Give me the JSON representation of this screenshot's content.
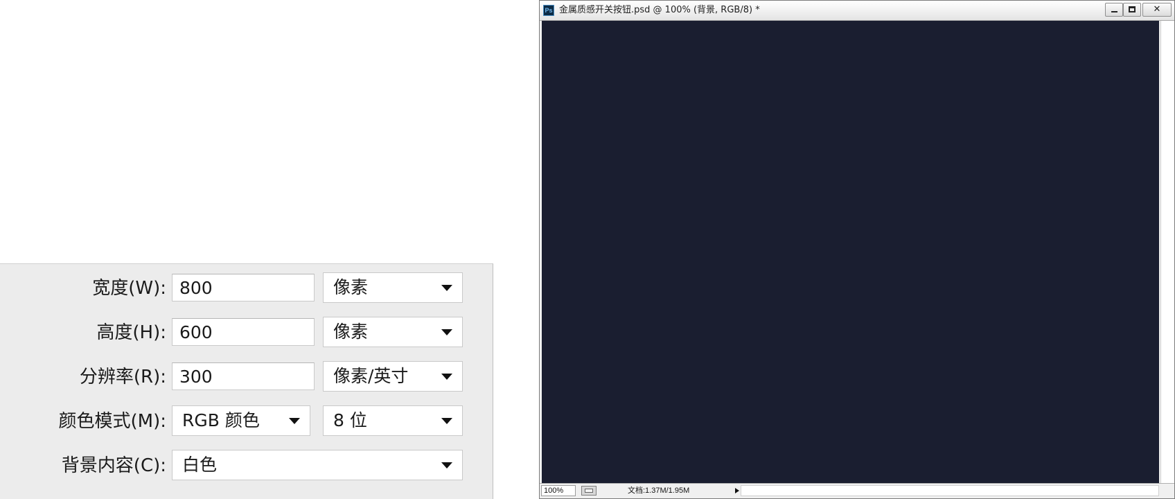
{
  "dialog": {
    "width": {
      "label": "宽度(W):",
      "value": "800",
      "unit": "像素"
    },
    "height": {
      "label": "高度(H):",
      "value": "600",
      "unit": "像素"
    },
    "resolution": {
      "label": "分辨率(R):",
      "value": "300",
      "unit": "像素/英寸"
    },
    "color_mode": {
      "label": "颜色模式(M):",
      "mode": "RGB 颜色",
      "bit_depth": "8 位"
    },
    "background": {
      "label": "背景内容(C):",
      "value": "白色"
    }
  },
  "document_window": {
    "app_icon": "Ps",
    "title": "金属质感开关按钮.psd @ 100% (背景, RGB/8) *",
    "buttons": {
      "minimize_icon": "minimize-icon",
      "maximize_icon": "maximize-icon",
      "close_label": "✕"
    },
    "canvas_color": "#1a1e30",
    "status": {
      "zoom": "100%",
      "doc_info": "文档:1.37M/1.95M"
    }
  }
}
